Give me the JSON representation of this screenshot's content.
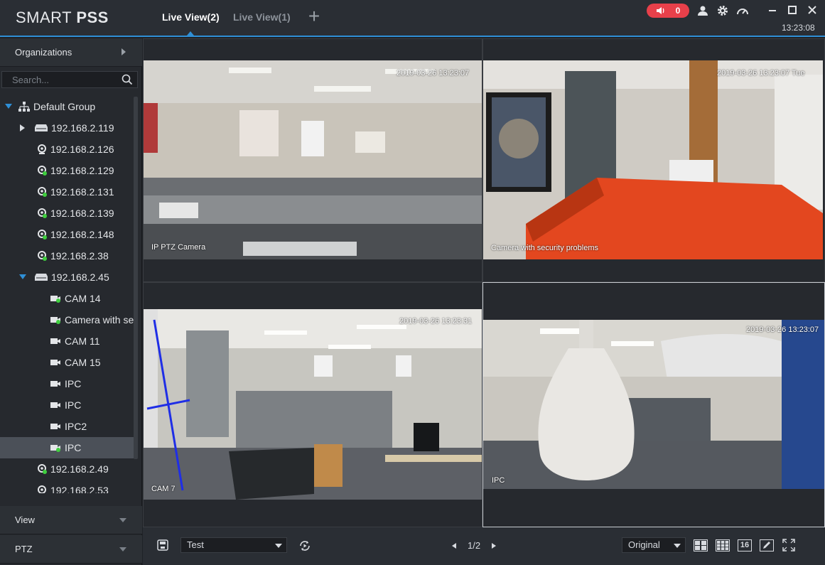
{
  "app": {
    "brand_light": "SMART ",
    "brand_bold": "PSS",
    "clock": "13:23:08",
    "alarm_count": "0"
  },
  "tabs": [
    {
      "label": "Live View(2)",
      "active": true
    },
    {
      "label": "Live View(1)",
      "active": false
    }
  ],
  "sidebar": {
    "organizations_label": "Organizations",
    "search_placeholder": "Search...",
    "tree": [
      {
        "label": "Default Group",
        "type": "group"
      },
      {
        "label": "192.168.2.119",
        "type": "nvr"
      },
      {
        "label": "192.168.2.126",
        "type": "camera-offline"
      },
      {
        "label": "192.168.2.129",
        "type": "camera-online"
      },
      {
        "label": "192.168.2.131",
        "type": "camera-online"
      },
      {
        "label": "192.168.2.139",
        "type": "camera-online"
      },
      {
        "label": "192.168.2.148",
        "type": "camera-online"
      },
      {
        "label": "192.168.2.38",
        "type": "camera-online"
      },
      {
        "label": "192.168.2.45",
        "type": "nvr-expanded"
      },
      {
        "label": "CAM 14",
        "type": "channel-online"
      },
      {
        "label": "Camera with se",
        "type": "channel-online"
      },
      {
        "label": "CAM 11",
        "type": "channel"
      },
      {
        "label": "CAM 15",
        "type": "channel"
      },
      {
        "label": "IPC",
        "type": "channel"
      },
      {
        "label": "IPC",
        "type": "channel"
      },
      {
        "label": "IPC2",
        "type": "channel"
      },
      {
        "label": "IPC",
        "type": "channel-online-selected"
      },
      {
        "label": "192.168.2.49",
        "type": "camera-online"
      },
      {
        "label": "192.168.2.53",
        "type": "camera-offline"
      }
    ],
    "view_label": "View",
    "ptz_label": "PTZ"
  },
  "cells": [
    {
      "timestamp": "2019-03-26 13:23:07",
      "name": "IP PTZ Camera"
    },
    {
      "timestamp": "2019-03-26 13:23:07 Tue",
      "name": "Camera with security problems"
    },
    {
      "timestamp": "2019-03-26 13:23:31",
      "name": "CAM 7"
    },
    {
      "timestamp": "2019-03-26 13:23:07",
      "name": "IPC"
    }
  ],
  "toolbar": {
    "view_select": "Test",
    "page_indicator": "1/2",
    "stream_select": "Original",
    "layout_16_label": "16"
  },
  "colors": {
    "accent": "#2f8fd6",
    "alarm": "#e8404a",
    "online": "#3fcf3f"
  }
}
